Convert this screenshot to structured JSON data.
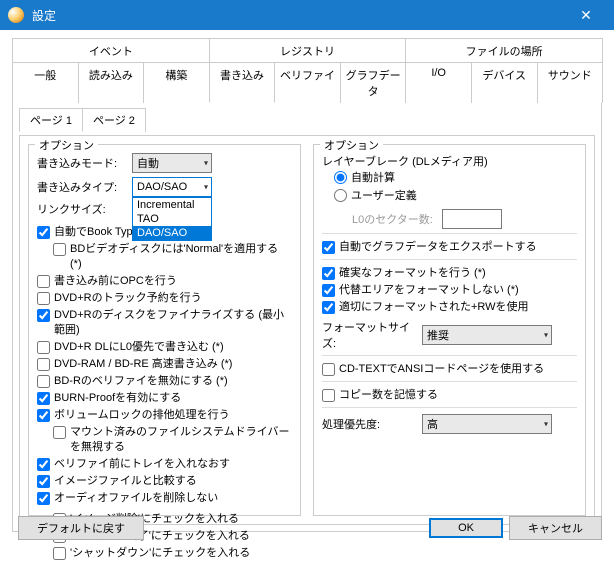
{
  "window": {
    "title": "設定"
  },
  "tabsRow1": [
    "イベント",
    "レジストリ",
    "ファイルの場所"
  ],
  "tabsRow2": [
    "一般",
    "読み込み",
    "構築",
    "書き込み",
    "ベリファイ",
    "グラフデータ",
    "I/O",
    "デバイス",
    "サウンド"
  ],
  "activeTabRow2": 3,
  "subtabs": [
    "ページ 1",
    "ページ 2"
  ],
  "activeSubtab": 0,
  "left": {
    "groupTitle": "オプション",
    "writeMode": {
      "label": "書き込みモード:",
      "value": "自動"
    },
    "writeType": {
      "label": "書き込みタイプ:",
      "value": "DAO/SAO",
      "options": [
        "Incremental",
        "TAO",
        "DAO/SAO"
      ],
      "selectedIndex": 2
    },
    "linkSize": {
      "label": "リンクサイズ:",
      "value": ""
    },
    "checks": [
      {
        "label": "自動でBook Typeを変更する (*)",
        "checked": true,
        "indent": 0
      },
      {
        "label": "BDビデオディスクには'Normal'を適用する (*)",
        "checked": false,
        "indent": 1
      },
      {
        "label": "書き込み前にOPCを行う",
        "checked": false,
        "indent": 0
      },
      {
        "label": "DVD+Rのトラック予約を行う",
        "checked": false,
        "indent": 0
      },
      {
        "label": "DVD+Rのディスクをファイナライズする (最小範囲)",
        "checked": true,
        "indent": 0
      },
      {
        "label": "DVD+R DLにL0優先で書き込む (*)",
        "checked": false,
        "indent": 0
      },
      {
        "label": "DVD-RAM / BD-RE 高速書き込み (*)",
        "checked": false,
        "indent": 0
      },
      {
        "label": "BD-Rのベリファイを無効にする (*)",
        "checked": false,
        "indent": 0
      },
      {
        "label": "BURN-Proofを有効にする",
        "checked": true,
        "indent": 0
      },
      {
        "label": "ボリュームロックの排他処理を行う",
        "checked": true,
        "indent": 0
      },
      {
        "label": "マウント済みのファイルシステムドライバーを無視する",
        "checked": false,
        "indent": 1
      },
      {
        "label": "ベリファイ前にトレイを入れなおす",
        "checked": true,
        "indent": 0
      },
      {
        "label": "イメージファイルと比較する",
        "checked": true,
        "indent": 0
      },
      {
        "label": "オーディオファイルを削除しない",
        "checked": true,
        "indent": 0
      }
    ],
    "checks2": [
      {
        "label": "'イメージ削除'にチェックを入れる",
        "checked": false
      },
      {
        "label": "'プログラム終了'にチェックを入れる",
        "checked": false
      },
      {
        "label": "'シャットダウン'にチェックを入れる",
        "checked": false
      }
    ]
  },
  "right": {
    "groupTitle": "オプション",
    "layerBreak": {
      "label": "レイヤーブレーク (DLメディア用)",
      "auto": "自動計算",
      "user": "ユーザー定義",
      "selected": "auto",
      "l0label": "L0のセクター数:"
    },
    "autoExport": {
      "label": "自動でグラフデータをエクスポートする",
      "checked": true
    },
    "formatChecks": [
      {
        "label": "確実なフォーマットを行う (*)",
        "checked": true
      },
      {
        "label": "代替エリアをフォーマットしない (*)",
        "checked": true
      },
      {
        "label": "適切にフォーマットされた+RWを使用",
        "checked": true
      }
    ],
    "formatSize": {
      "label": "フォーマットサイズ:",
      "value": "推奨"
    },
    "cdtext": {
      "label": "CD-TEXTでANSIコードページを使用する",
      "checked": false
    },
    "rememberCopies": {
      "label": "コピー数を記憶する",
      "checked": false
    },
    "priority": {
      "label": "処理優先度:",
      "value": "高"
    }
  },
  "footer": {
    "defaults": "デフォルトに戻す",
    "ok": "OK",
    "cancel": "キャンセル"
  }
}
